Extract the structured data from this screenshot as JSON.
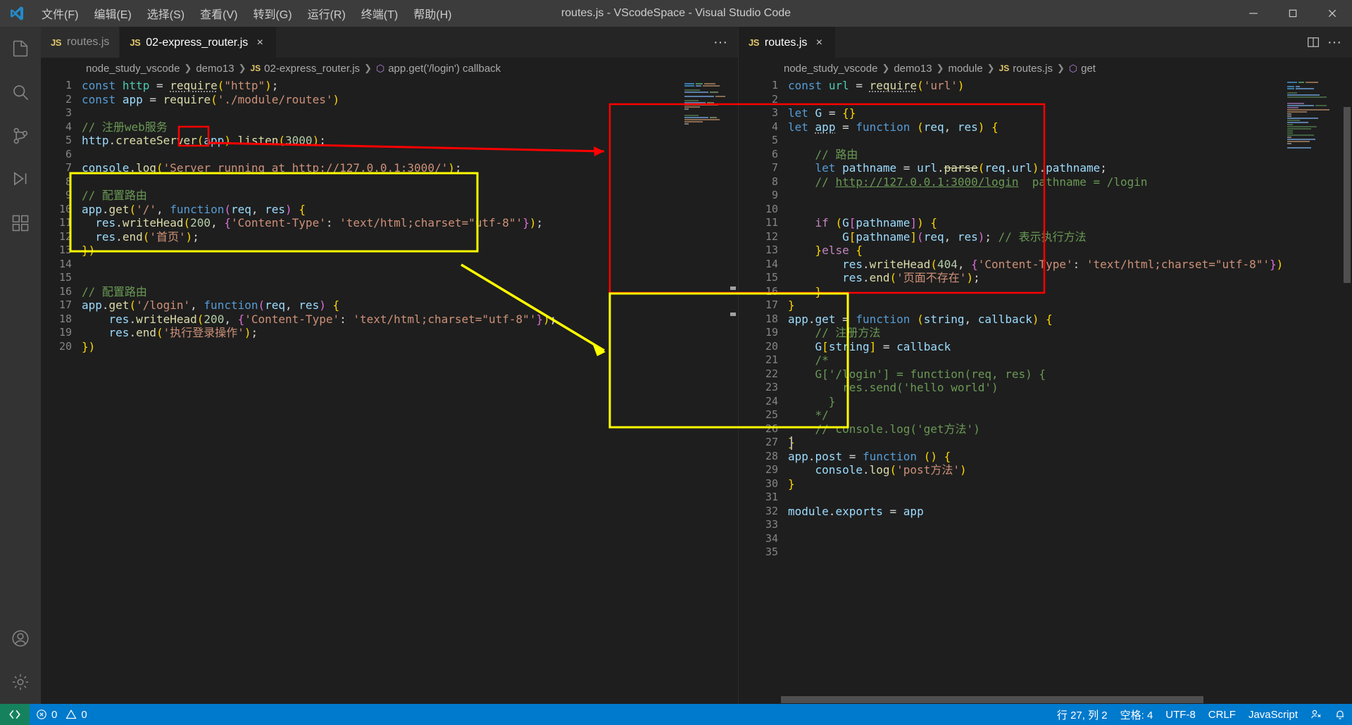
{
  "window": {
    "title": "routes.js - VScodeSpace - Visual Studio Code",
    "logo_icon": "vscode-logo",
    "minimize_label": "minimize-icon",
    "restore_label": "restore-icon",
    "close_label": "close-icon"
  },
  "menu": [
    {
      "label": "文件(F)"
    },
    {
      "label": "编辑(E)"
    },
    {
      "label": "选择(S)"
    },
    {
      "label": "查看(V)"
    },
    {
      "label": "转到(G)"
    },
    {
      "label": "运行(R)"
    },
    {
      "label": "终端(T)"
    },
    {
      "label": "帮助(H)"
    }
  ],
  "activitybar": [
    {
      "name": "explorer",
      "icon": "files-icon",
      "active": false
    },
    {
      "name": "search",
      "icon": "search-icon",
      "active": false
    },
    {
      "name": "source-control",
      "icon": "source-control-icon",
      "active": false
    },
    {
      "name": "run-debug",
      "icon": "run-debug-icon",
      "active": false
    },
    {
      "name": "extensions",
      "icon": "extensions-icon",
      "active": false
    },
    {
      "name": "accounts",
      "icon": "account-icon",
      "active": false
    },
    {
      "name": "settings",
      "icon": "gear-icon",
      "active": false
    }
  ],
  "left_group": {
    "tabs": [
      {
        "label": "routes.js",
        "badge": "JS",
        "active": false,
        "closable": false
      },
      {
        "label": "02-express_router.js",
        "badge": "JS",
        "active": true,
        "closable": true
      }
    ],
    "more_actions_label": "···",
    "breadcrumb": [
      {
        "text": "node_study_vscode",
        "kind": "folder"
      },
      {
        "text": "demo13",
        "kind": "folder"
      },
      {
        "text": "02-express_router.js",
        "kind": "file",
        "badge": "JS"
      },
      {
        "text": "app.get('/login') callback",
        "kind": "symbol",
        "badge": "sym"
      }
    ],
    "lines": [
      {
        "n": 1,
        "text": "const http = require(\"http\");"
      },
      {
        "n": 2,
        "text": "const app = require('./module/routes')"
      },
      {
        "n": 3,
        "text": ""
      },
      {
        "n": 4,
        "text": "// 注册web服务"
      },
      {
        "n": 5,
        "text": "http.createServer(app).listen(3000);"
      },
      {
        "n": 6,
        "text": ""
      },
      {
        "n": 7,
        "text": "console.log('Server running at http://127.0.0.1:3000/');"
      },
      {
        "n": 8,
        "text": ""
      },
      {
        "n": 9,
        "text": "// 配置路由"
      },
      {
        "n": 10,
        "text": "app.get('/', function(req, res) {"
      },
      {
        "n": 11,
        "text": "  res.writeHead(200, {'Content-Type': 'text/html;charset=\"utf-8\"'});"
      },
      {
        "n": 12,
        "text": "  res.end('首页');"
      },
      {
        "n": 13,
        "text": "})"
      },
      {
        "n": 14,
        "text": ""
      },
      {
        "n": 15,
        "text": ""
      },
      {
        "n": 16,
        "text": "// 配置路由"
      },
      {
        "n": 17,
        "text": "app.get('/login', function(req, res) {"
      },
      {
        "n": 18,
        "text": "    res.writeHead(200, {'Content-Type': 'text/html;charset=\"utf-8\"'});"
      },
      {
        "n": 19,
        "text": "    res.end('执行登录操作');"
      },
      {
        "n": 20,
        "text": "})"
      }
    ]
  },
  "right_group": {
    "tabs": [
      {
        "label": "routes.js",
        "badge": "JS",
        "active": true,
        "closable": true
      }
    ],
    "split_editor_label": "split-editor-icon",
    "more_actions_label": "···",
    "breadcrumb": [
      {
        "text": "node_study_vscode",
        "kind": "folder"
      },
      {
        "text": "demo13",
        "kind": "folder"
      },
      {
        "text": "module",
        "kind": "folder"
      },
      {
        "text": "routes.js",
        "kind": "file",
        "badge": "JS"
      },
      {
        "text": "get",
        "kind": "symbol",
        "badge": "sym"
      }
    ],
    "lines": [
      {
        "n": 1,
        "text": "const url = require('url')"
      },
      {
        "n": 2,
        "text": ""
      },
      {
        "n": 3,
        "text": "let G = {}"
      },
      {
        "n": 4,
        "text": "let app = function (req, res) {"
      },
      {
        "n": 5,
        "text": ""
      },
      {
        "n": 6,
        "text": "    // 路由"
      },
      {
        "n": 7,
        "text": "    let pathname = url.parse(req.url).pathname;"
      },
      {
        "n": 8,
        "text": "    // http://127.0.0.1:3000/login  pathname = /login"
      },
      {
        "n": 9,
        "text": ""
      },
      {
        "n": 10,
        "text": ""
      },
      {
        "n": 11,
        "text": "    if (G[pathname]) {"
      },
      {
        "n": 12,
        "text": "        G[pathname](req, res); // 表示执行方法"
      },
      {
        "n": 13,
        "text": "    }else {"
      },
      {
        "n": 14,
        "text": "        res.writeHead(404, {'Content-Type': 'text/html;charset=\"utf-8\"'});"
      },
      {
        "n": 15,
        "text": "        res.end('页面不存在');"
      },
      {
        "n": 16,
        "text": "    }"
      },
      {
        "n": 17,
        "text": "}"
      },
      {
        "n": 18,
        "text": "app.get = function (string, callback) {"
      },
      {
        "n": 19,
        "text": "    // 注册方法"
      },
      {
        "n": 20,
        "text": "    G[string] = callback"
      },
      {
        "n": 21,
        "text": "    /*"
      },
      {
        "n": 22,
        "text": "    G['/login'] = function(req, res) {"
      },
      {
        "n": 23,
        "text": "        res.send('hello world')"
      },
      {
        "n": 24,
        "text": "      }"
      },
      {
        "n": 25,
        "text": "    */"
      },
      {
        "n": 26,
        "text": "    // console.log('get方法')"
      },
      {
        "n": 27,
        "text": "}"
      },
      {
        "n": 28,
        "text": "app.post = function () {"
      },
      {
        "n": 29,
        "text": "    console.log('post方法')"
      },
      {
        "n": 30,
        "text": "}"
      },
      {
        "n": 31,
        "text": ""
      },
      {
        "n": 32,
        "text": "module.exports = app"
      },
      {
        "n": 33,
        "text": ""
      },
      {
        "n": 34,
        "text": ""
      },
      {
        "n": 35,
        "text": ""
      }
    ]
  },
  "annotations": {
    "red_box_left_label": "highlight-app-argument",
    "red_box_right_label": "highlight-app-function-body",
    "yellow_box_left_label": "highlight-app-get-route",
    "yellow_box_right_label": "highlight-app-get-definition",
    "red_arrow_label": "red-arrow",
    "yellow_arrow_label": "yellow-arrow",
    "red_color": "#ff0000",
    "yellow_color": "#ffff00"
  },
  "statusbar": {
    "remote_icon": "remote-icon",
    "errors_icon": "error-icon",
    "errors": "0",
    "warnings_icon": "warning-icon",
    "warnings": "0",
    "cursor_position": "行 27, 列 2",
    "indentation": "空格: 4",
    "encoding": "UTF-8",
    "eol": "CRLF",
    "language": "JavaScript",
    "live_share_icon": "live-share-icon",
    "bell_icon": "bell-icon",
    "accent_color": "#007acc",
    "remote_color": "#16825d"
  }
}
